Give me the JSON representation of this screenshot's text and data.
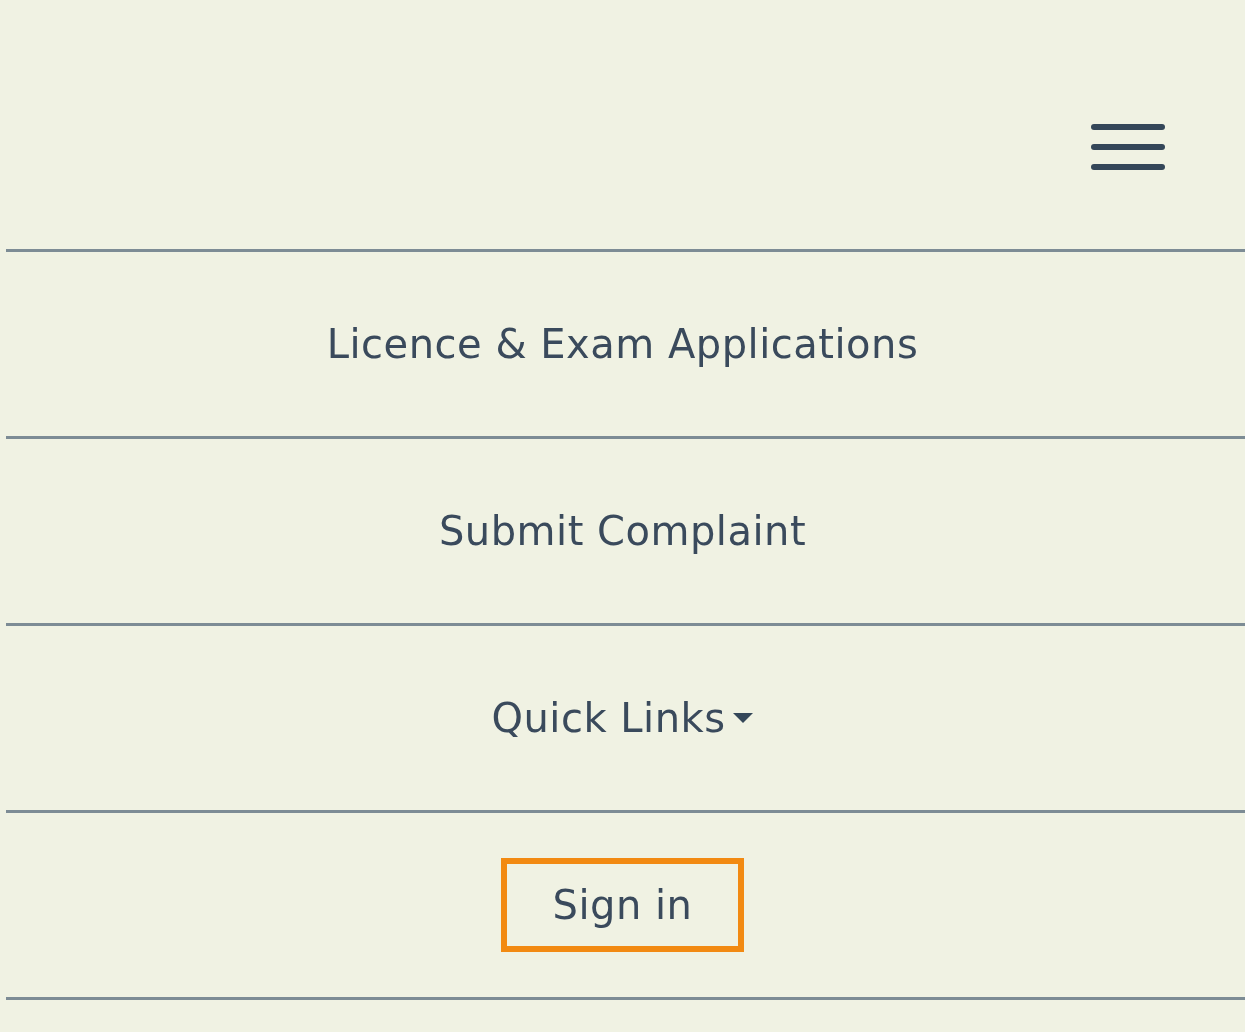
{
  "nav_items": [
    {
      "label": "Licence & Exam Applications",
      "kind": "link",
      "highlighted": false
    },
    {
      "label": "Submit Complaint",
      "kind": "link",
      "highlighted": false
    },
    {
      "label": "Quick Links",
      "kind": "dropdown",
      "highlighted": false
    },
    {
      "label": "Sign in",
      "kind": "link",
      "highlighted": true
    }
  ]
}
